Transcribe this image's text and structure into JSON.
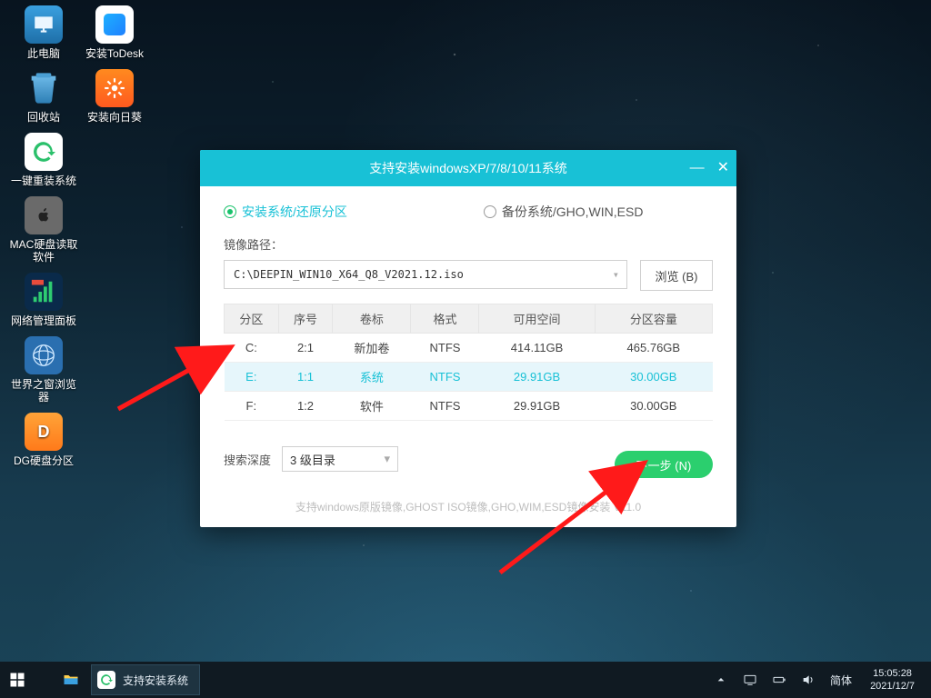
{
  "desktop_icons_col1": [
    {
      "id": "this-pc",
      "label": "此电脑"
    },
    {
      "id": "recycle-bin",
      "label": "回收站"
    },
    {
      "id": "one-key-reinstall",
      "label": "一键重装系统"
    },
    {
      "id": "mac-disk-reader",
      "label": "MAC硬盘读取软件"
    },
    {
      "id": "net-panel",
      "label": "网络管理面板"
    },
    {
      "id": "world-browser",
      "label": "世界之窗浏览器"
    },
    {
      "id": "dg-partition",
      "label": "DG硬盘分区"
    }
  ],
  "desktop_icons_col2": [
    {
      "id": "install-todesk",
      "label": "安装ToDesk"
    },
    {
      "id": "install-sunflower",
      "label": "安装向日葵"
    }
  ],
  "installer": {
    "title": "支持安装windowsXP/7/8/10/11系统",
    "radio_install": "安装系统/还原分区",
    "radio_backup": "备份系统/GHO,WIN,ESD",
    "path_label": "镜像路径：",
    "path_value": "C:\\DEEPIN_WIN10_X64_Q8_V2021.12.iso",
    "browse": "浏览 (B)",
    "table_headers": [
      "分区",
      "序号",
      "卷标",
      "格式",
      "可用空间",
      "分区容量"
    ],
    "rows": [
      {
        "drive": "C:",
        "index": "2:1",
        "label": "新加卷",
        "fs": "NTFS",
        "free": "414.11GB",
        "total": "465.76GB"
      },
      {
        "drive": "E:",
        "index": "1:1",
        "label": "系统",
        "fs": "NTFS",
        "free": "29.91GB",
        "total": "30.00GB"
      },
      {
        "drive": "F:",
        "index": "1:2",
        "label": "软件",
        "fs": "NTFS",
        "free": "29.91GB",
        "total": "30.00GB"
      }
    ],
    "depth_label": "搜索深度",
    "depth_value": "3 级目录",
    "next": "下一步 (N)",
    "support_line": "支持windows原版镜像,GHOST ISO镜像,GHO,WIM,ESD镜像安装 V11.0"
  },
  "taskbar": {
    "app_title": "支持安装系统",
    "ime": "简体",
    "time": "15:05:28",
    "date": "2021/12/7"
  }
}
